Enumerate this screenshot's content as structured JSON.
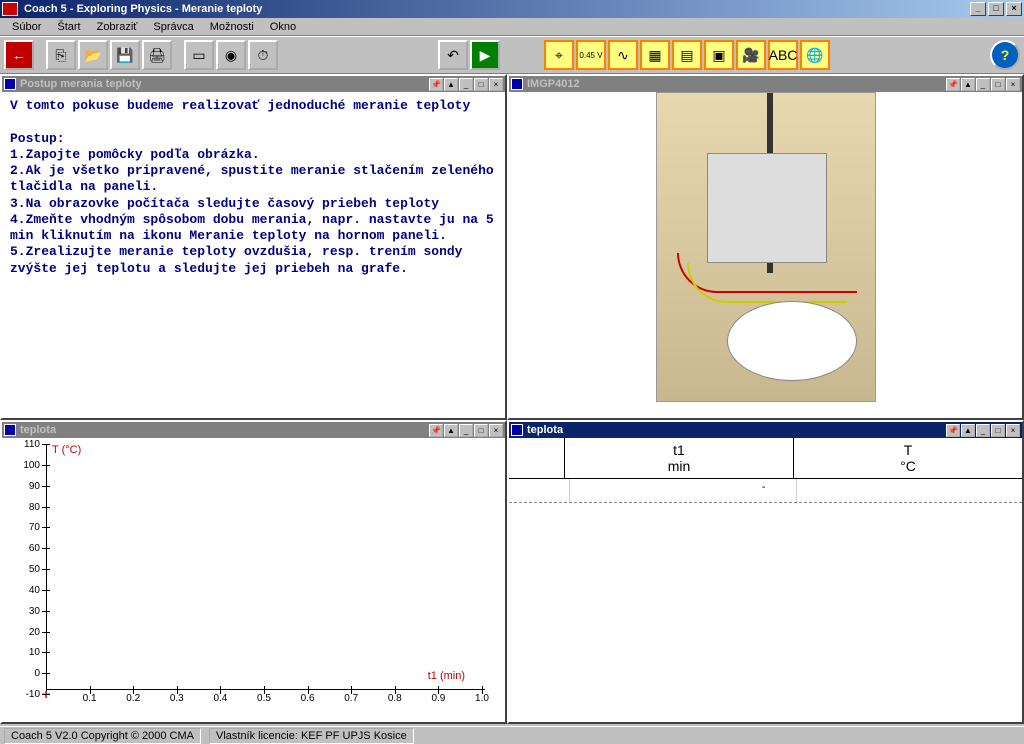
{
  "window": {
    "title": "Coach 5 - Exploring Physics - Meranie teploty",
    "btn_min": "_",
    "btn_max": "□",
    "btn_close": "×"
  },
  "menubar": [
    "Súbor",
    "Štart",
    "Zobraziť",
    "Správca",
    "Možnosti",
    "Okno"
  ],
  "toolbar": {
    "back": "←",
    "copy1": "⎘",
    "open": "📂",
    "save": "💾",
    "print": "🖨",
    "panel": "▭",
    "sensor": "◉",
    "timer": "⏱",
    "undo": "↶",
    "run": "▶",
    "g1": "⌖",
    "g2": "0.45 V",
    "g3": "∿",
    "g4": "▦",
    "g5": "▤",
    "g6": "▣",
    "g7": "🎥",
    "g8": "ABC",
    "g9": "🌐",
    "help": "?"
  },
  "panes": {
    "instructions": {
      "title": "Postup merania teploty",
      "text": "V tomto pokuse budeme realizovať jednoduché meranie teploty\n\nPostup:\n1.Zapojte pomôcky podľa obrázka.\n2.Ak je všetko pripravené, spustite meranie stlačením zeleného tlačidla na paneli.\n3.Na obrazovke počítača sledujte časový priebeh teploty\n4.Zmeňte vhodným spôsobom dobu merania, napr. nastavte ju na 5 min kliknutím na ikonu Meranie teploty na hornom paneli.\n5.Zrealizujte meranie teploty ovzdušia, resp. trením sondy zvýšte jej teplotu a sledujte jej priebeh na grafe."
    },
    "image": {
      "title": "IMGP4012"
    },
    "chart": {
      "title": "teplota"
    },
    "table": {
      "title": "teplota",
      "col1_name": "t1",
      "col1_unit": "min",
      "col2_name": "T",
      "col2_unit": "°C",
      "row1_val": "-"
    },
    "pbtn_pin": "📌",
    "pbtn_up": "▲",
    "pbtn_min": "_",
    "pbtn_max": "□",
    "pbtn_close": "×"
  },
  "chart_data": {
    "type": "line",
    "title": "",
    "xlabel": "t1 (min)",
    "ylabel": "T (°C)",
    "xlim": [
      0,
      1.0
    ],
    "ylim": [
      -10,
      110
    ],
    "yticks": [
      -10,
      0,
      10,
      20,
      30,
      40,
      50,
      60,
      70,
      80,
      90,
      100,
      110
    ],
    "xticks": [
      0.1,
      0.2,
      0.3,
      0.4,
      0.5,
      0.6,
      0.7,
      0.8,
      0.9,
      1.0
    ],
    "series": [
      {
        "name": "T",
        "values": []
      }
    ]
  },
  "statusbar": {
    "left": "Coach 5 V2.0 Copyright © 2000 CMA",
    "right": "Vlastník licencie: KEF PF UPJS Kosice"
  }
}
